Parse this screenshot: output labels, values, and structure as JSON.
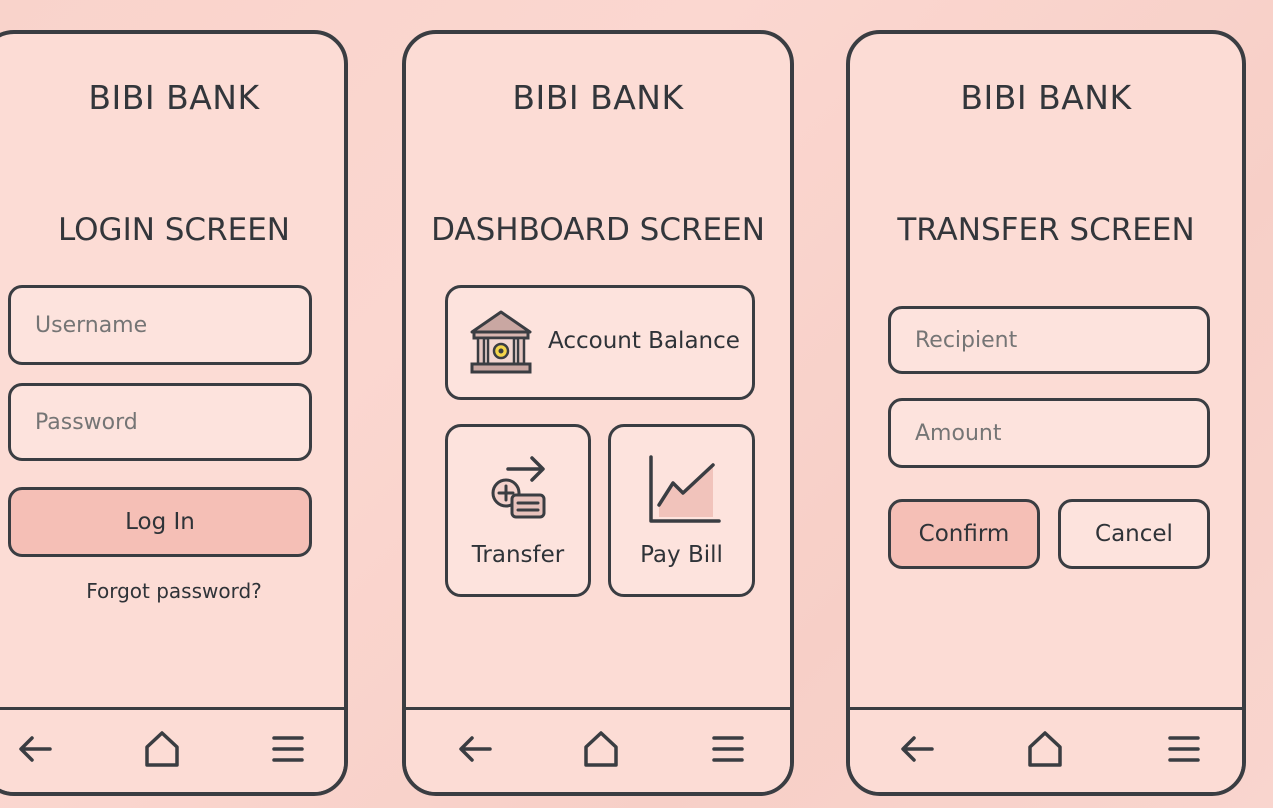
{
  "colors": {
    "background": "#f9d3cb",
    "phone_fill": "#fcdcd5",
    "outline": "#3a3d42",
    "primary_button": "#f5bfb6",
    "field_fill": "#fde3dd",
    "accent_icon": "#c9a7a2"
  },
  "bank_name": "BIBI BANK",
  "login": {
    "title": "LOGIN SCREEN",
    "username_placeholder": "Username",
    "password_placeholder": "Password",
    "login_label": "Log In",
    "forgot_label": "Forgot password?"
  },
  "dashboard": {
    "title": "DASHBOARD SCREEN",
    "balance_label": "Account Balance",
    "balance_icon": "bank-icon",
    "transfer_label": "Transfer",
    "transfer_icon": "transfer-icon",
    "paybill_label": "Pay Bill",
    "paybill_icon": "chart-icon"
  },
  "transfer": {
    "title": "TRANSFER SCREEN",
    "recipient_placeholder": "Recipient",
    "amount_placeholder": "Amount",
    "confirm_label": "Confirm",
    "cancel_label": "Cancel"
  },
  "navbar": {
    "icons": [
      "back-arrow-icon",
      "home-icon",
      "menu-icon"
    ]
  }
}
